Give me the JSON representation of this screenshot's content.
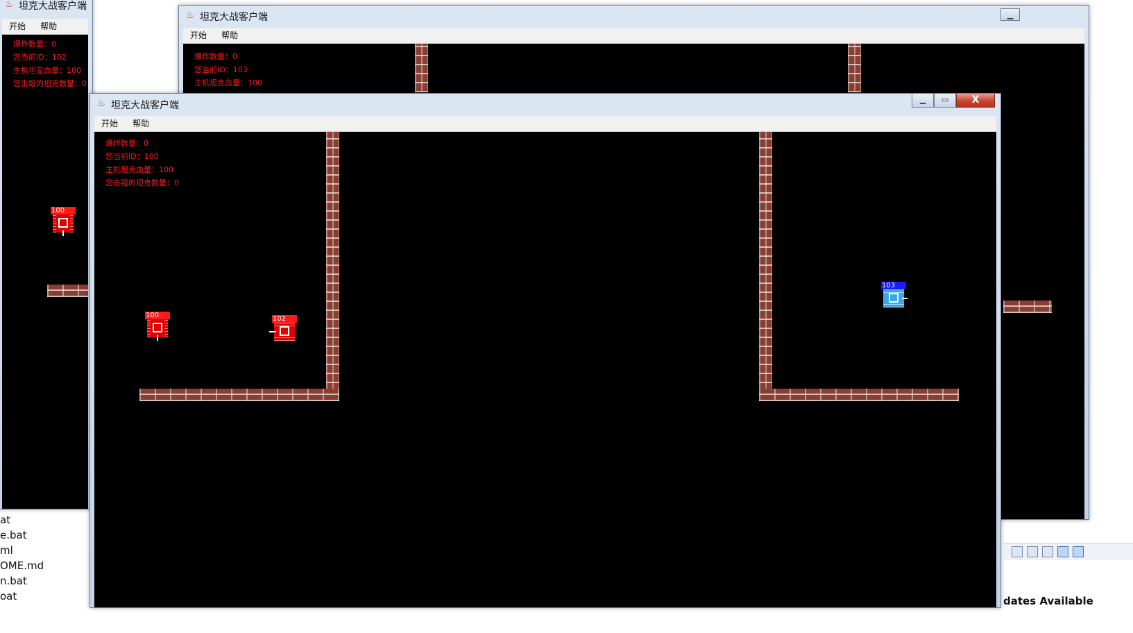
{
  "window_title": "坦克大战客户端",
  "menus": [
    "开始",
    "帮助"
  ],
  "windows": {
    "back_left": {
      "hud": [
        "爆炸数量：0",
        "您当前ID：102",
        "主机坦克血量：100",
        "您击毁的坦克数量：0"
      ]
    },
    "back_right": {
      "hud": [
        "爆炸数量：0",
        "您当前ID：103",
        "主机坦克血量：100"
      ]
    },
    "front": {
      "hud": [
        "爆炸数量：0",
        "您当前ID：100",
        "主机坦克血量：100",
        "您击毁的坦克数量：0"
      ],
      "controls": {
        "minimize": "▁",
        "maximize": "▭",
        "close": "X"
      }
    }
  },
  "tanks": {
    "back_left_100": {
      "label": "100",
      "color": "#ff0000"
    },
    "front_100": {
      "label": "100",
      "color": "#ff0000"
    },
    "front_102": {
      "label": "102",
      "color": "#ff0000"
    },
    "front_103": {
      "label": "103",
      "color": "#0000ff"
    }
  },
  "desktop": {
    "files": [
      "at",
      "e.bat",
      "ml",
      "OME.md",
      "n.bat",
      "oat"
    ],
    "updates_text": "dates Available"
  },
  "icons": {
    "app": "java-coffee-icon",
    "brick": "brick-wall"
  }
}
